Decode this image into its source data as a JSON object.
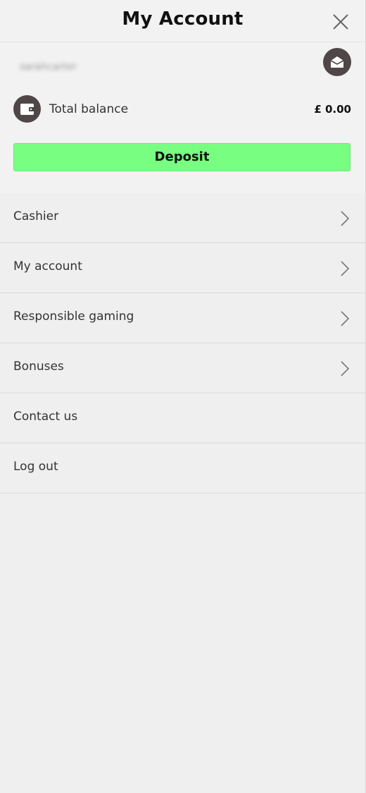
{
  "header": {
    "title": "My Account",
    "close_icon": "close-icon"
  },
  "account": {
    "username": "sarahcarter",
    "mail_icon": "mail-icon",
    "wallet_icon": "wallet-icon",
    "balance_label": "Total balance",
    "balance_value": "£ 0.00",
    "deposit_label": "Deposit"
  },
  "menu": {
    "items": [
      {
        "label": "Cashier",
        "has_chevron": true
      },
      {
        "label": "My account",
        "has_chevron": true
      },
      {
        "label": "Responsible gaming",
        "has_chevron": true
      },
      {
        "label": "Bonuses",
        "has_chevron": true
      },
      {
        "label": "Contact us",
        "has_chevron": false
      },
      {
        "label": "Log out",
        "has_chevron": false
      }
    ]
  },
  "colors": {
    "background": "#efefef",
    "deposit_green": "#78ff82",
    "icon_circle": "#4f4648"
  }
}
